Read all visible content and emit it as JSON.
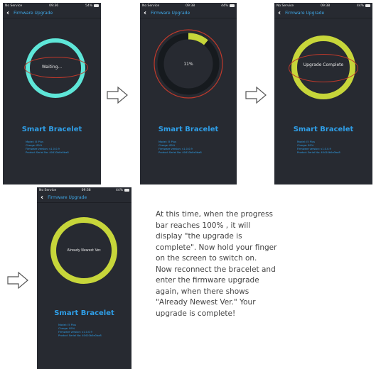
{
  "common": {
    "nav_title": "Firmware Upgrade",
    "device_name": "Smart Bracelet",
    "info_lines": [
      "Model: I5 Plus",
      "Charge: 89%",
      "Firmware version: v1.0.0.9",
      "Product Serial No: 40410b0e0ba8"
    ],
    "time": "09:38",
    "carrier": "No Service",
    "battery": "44%",
    "colors": {
      "screen_bg": "#272a31",
      "ring_waiting": "#5ee6d8",
      "ring_progress": "#c7d63a",
      "ring_track": "#161a1e",
      "highlight_red": "#c0392b",
      "accent_blue": "#2f9fe8"
    }
  },
  "screens": [
    {
      "label": "Waiting...",
      "time": "09:36",
      "battery": "54%",
      "state": "waiting"
    },
    {
      "label": "11%",
      "time": "09:38",
      "battery": "44%",
      "state": "progress",
      "progress_percent": 11
    },
    {
      "label": "Upgrade Complete",
      "time": "09:38",
      "battery": "44%",
      "state": "complete"
    },
    {
      "label": "Already Newest Ver.",
      "time": "09:38",
      "battery": "44%",
      "state": "newest"
    }
  ],
  "description": "At this time, when the progress\nbar reaches 100% , it will\ndisplay \"the upgrade is\ncomplete\". Now hold your finger\non the screen to switch on.\nNow reconnect the bracelet and\nenter the firmware upgrade\nagain, when there shows\n\"Already Newest Ver.\" Your\nupgrade is complete!",
  "arrow_icon": "hollow-right-arrow-icon"
}
